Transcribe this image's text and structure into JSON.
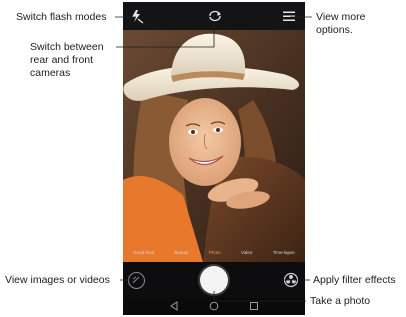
{
  "callouts": {
    "flash": "Switch flash modes",
    "switch_line1": "Switch between",
    "switch_line2": "rear and front",
    "switch_line3": "cameras",
    "more_line1": "View more",
    "more_line2": "options.",
    "gallery": "View images or videos",
    "filter": "Apply filter effects",
    "photo": "Take a photo"
  },
  "camera": {
    "modes": [
      "Good food",
      "Beauty",
      "Photo",
      "Video",
      "Time-lapse"
    ],
    "active_mode": "Photo"
  },
  "icons": {
    "flash": "flash-icon",
    "switch_camera": "switch-camera-icon",
    "more": "menu-icon",
    "gallery": "gallery-thumbnail",
    "shutter": "shutter-button",
    "filter": "filter-icon",
    "back": "back-icon",
    "home": "home-icon",
    "recents": "recents-icon"
  },
  "colors": {
    "active_mode": "#f2a13a",
    "callout_line": "#1e1e1e"
  }
}
